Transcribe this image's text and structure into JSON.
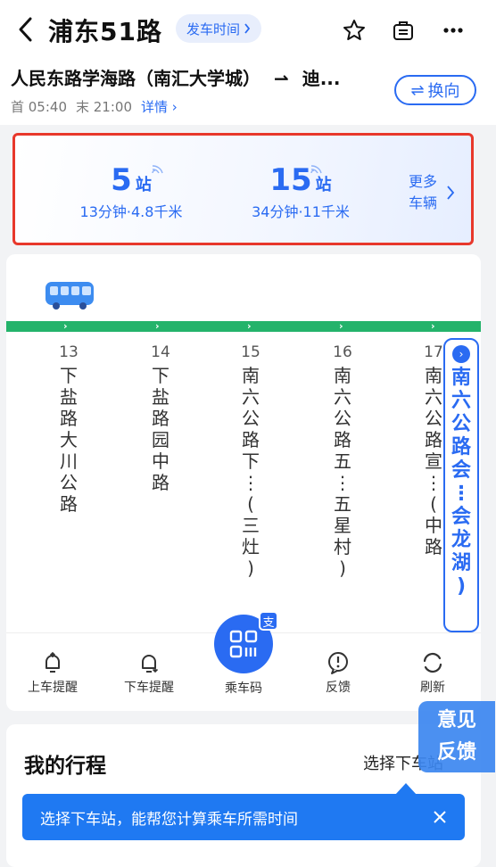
{
  "header": {
    "title": "浦东51路",
    "schedule_label": "发车时间",
    "route": "人民东路学海路（南汇大学城）",
    "route_to": "迪...",
    "first_label": "首 05:40",
    "last_label": "末 21:00",
    "detail_label": "详情",
    "reverse_label": "换向"
  },
  "arrival": {
    "buses": [
      {
        "stops": "5",
        "unit": "站",
        "info": "13分钟·4.8千米"
      },
      {
        "stops": "15",
        "unit": "站",
        "info": "34分钟·11千米"
      }
    ],
    "more_line1": "更多",
    "more_line2": "车辆"
  },
  "stops": [
    {
      "idx": "13",
      "name": [
        "下",
        "盐",
        "路",
        "大",
        "川",
        "公",
        "路"
      ]
    },
    {
      "idx": "14",
      "name": [
        "下",
        "盐",
        "路",
        "园",
        "中",
        "路"
      ]
    },
    {
      "idx": "15",
      "name": [
        "南",
        "六",
        "公",
        "路",
        "下",
        "⋮",
        "(",
        "三",
        "灶",
        ")"
      ]
    },
    {
      "idx": "16",
      "name": [
        "南",
        "六",
        "公",
        "路",
        "五",
        "⋮",
        "五",
        "星",
        "村",
        ")"
      ]
    },
    {
      "idx": "17",
      "name": [
        "南",
        "六",
        "公",
        "路",
        "宣",
        "⋮",
        "(",
        "中",
        "路"
      ]
    }
  ],
  "destination": {
    "name": [
      "南",
      "六",
      "公",
      "路",
      "会",
      "⋮",
      "会",
      "龙",
      "湖",
      ")"
    ]
  },
  "toolbar": {
    "board_alert": "上车提醒",
    "alight_alert": "下车提醒",
    "ride_code": "乘车码",
    "ride_code_badge": "支",
    "feedback": "反馈",
    "refresh": "刷新"
  },
  "trip": {
    "heading": "我的行程",
    "select_stop": "选择下车站",
    "tip": "选择下车站，能帮您计算乘车所需时间"
  },
  "float_feedback": {
    "line1": "意见",
    "line2": "反馈"
  },
  "colors": {
    "accent": "#2a6bf2",
    "track": "#24b36b",
    "highlight_border": "#e8382b"
  }
}
